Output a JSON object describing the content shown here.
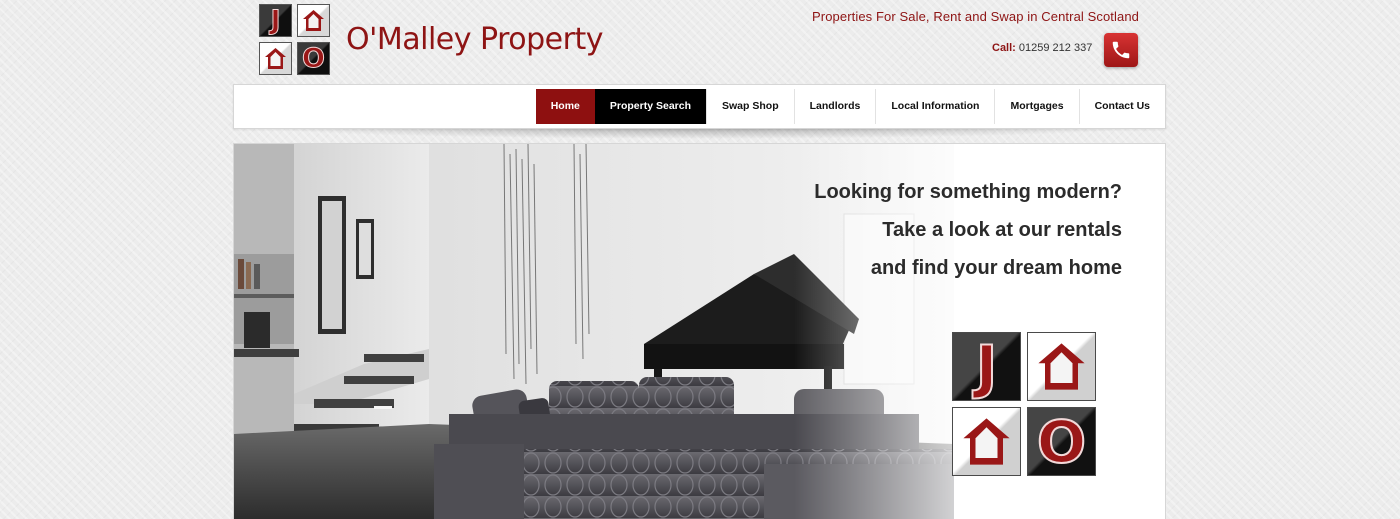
{
  "brand": {
    "logo_letters": [
      "J",
      "O"
    ],
    "name": "O'Malley Property"
  },
  "header": {
    "tagline": "Properties For Sale, Rent and Swap in Central Scotland",
    "call_label": "Call:",
    "phone": "01259 212 337",
    "phone_icon": "phone-icon"
  },
  "nav": {
    "items": [
      {
        "label": "Home"
      },
      {
        "label": "Property Search"
      },
      {
        "label": "Swap Shop"
      },
      {
        "label": "Landlords"
      },
      {
        "label": "Local Information"
      },
      {
        "label": "Mortgages"
      },
      {
        "label": "Contact Us"
      }
    ]
  },
  "hero": {
    "lines": [
      "Looking for something modern?",
      "Take a look at our rentals",
      "and find your dream home"
    ]
  },
  "colors": {
    "brand": "#8e1414",
    "nav_home": "#8e1010",
    "nav_active": "#000000"
  }
}
